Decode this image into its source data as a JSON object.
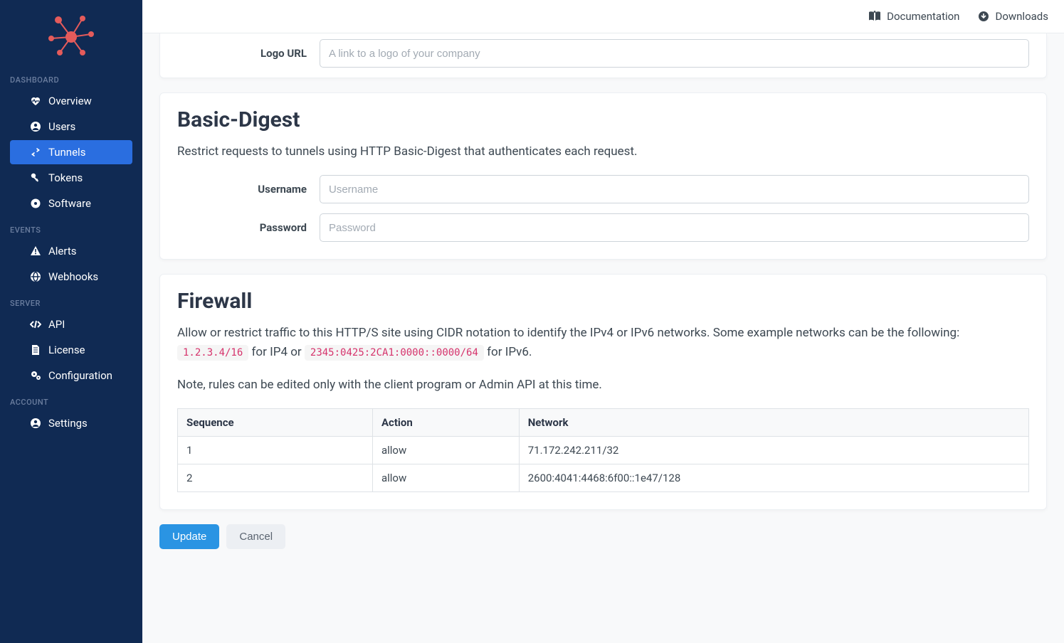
{
  "topbar": {
    "documentation": "Documentation",
    "downloads": "Downloads"
  },
  "sidebar": {
    "sections": {
      "dashboard": {
        "label": "DASHBOARD"
      },
      "events": {
        "label": "EVENTS"
      },
      "server": {
        "label": "SERVER"
      },
      "account": {
        "label": "ACCOUNT"
      }
    },
    "items": {
      "overview": {
        "label": "Overview"
      },
      "users": {
        "label": "Users"
      },
      "tunnels": {
        "label": "Tunnels"
      },
      "tokens": {
        "label": "Tokens"
      },
      "software": {
        "label": "Software"
      },
      "alerts": {
        "label": "Alerts"
      },
      "webhooks": {
        "label": "Webhooks"
      },
      "api": {
        "label": "API"
      },
      "license": {
        "label": "License"
      },
      "configuration": {
        "label": "Configuration"
      },
      "settings": {
        "label": "Settings"
      }
    }
  },
  "logo_card": {
    "logo_url_label": "Logo URL",
    "logo_url_placeholder": "A link to a logo of your company",
    "logo_url_value": ""
  },
  "basic_digest": {
    "title": "Basic-Digest",
    "description": "Restrict requests to tunnels using HTTP Basic-Digest that authenticates each request.",
    "username_label": "Username",
    "username_placeholder": "Username",
    "username_value": "",
    "password_label": "Password",
    "password_placeholder": "Password",
    "password_value": ""
  },
  "firewall": {
    "title": "Firewall",
    "description_pre": "Allow or restrict traffic to this HTTP/S site using CIDR notation to identify the IPv4 or IPv6 networks. Some example networks can be the following: ",
    "example_ip4": "1.2.3.4/16",
    "mid1": " for IP4 or ",
    "example_ip6": "2345:0425:2CA1:0000::0000/64",
    "mid2": " for IPv6.",
    "note": "Note, rules can be edited only with the client program or Admin API at this time.",
    "columns": {
      "sequence": "Sequence",
      "action": "Action",
      "network": "Network"
    },
    "rules": [
      {
        "sequence": "1",
        "action": "allow",
        "network": "71.172.242.211/32"
      },
      {
        "sequence": "2",
        "action": "allow",
        "network": "2600:4041:4468:6f00::1e47/128"
      }
    ]
  },
  "actions": {
    "update": "Update",
    "cancel": "Cancel"
  }
}
